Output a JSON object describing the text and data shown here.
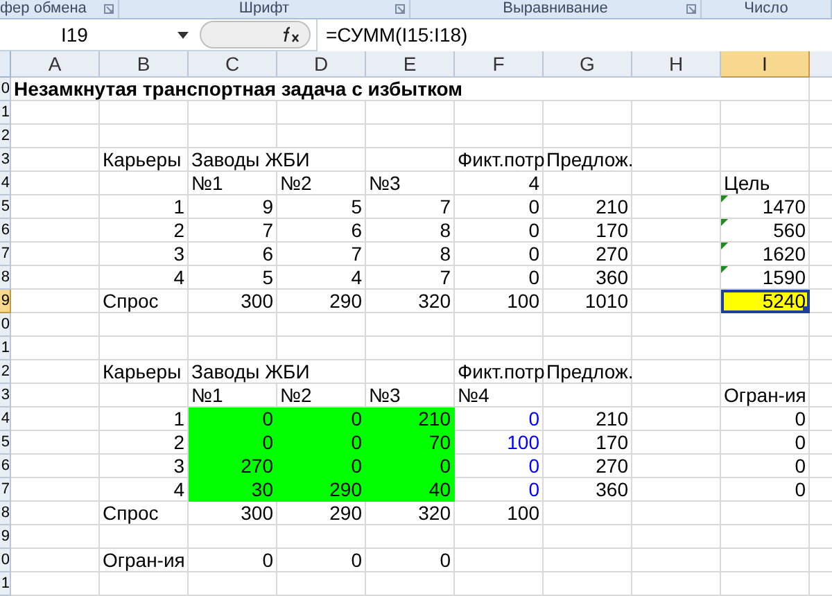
{
  "ribbon_groups": [
    {
      "label": "фер обмена"
    },
    {
      "label": "Шрифт"
    },
    {
      "label": "Выравнивание"
    },
    {
      "label": "Число"
    }
  ],
  "name_box": "I19",
  "formula": "=СУММ(I15:I18)",
  "columns": [
    {
      "label": "A",
      "selected": false
    },
    {
      "label": "B",
      "selected": false
    },
    {
      "label": "C",
      "selected": false
    },
    {
      "label": "D",
      "selected": false
    },
    {
      "label": "E",
      "selected": false
    },
    {
      "label": "F",
      "selected": false
    },
    {
      "label": "G",
      "selected": false
    },
    {
      "label": "H",
      "selected": false
    },
    {
      "label": "I",
      "selected": true
    }
  ],
  "rows": [
    {
      "number": "0",
      "selected": false,
      "cells": [
        {
          "text": "Незамкнутая транспортная задача с избытком",
          "kind": "title"
        },
        {
          "kind": "empty"
        },
        {
          "kind": "empty"
        },
        {
          "kind": "empty"
        },
        {
          "kind": "empty"
        },
        {
          "kind": "empty"
        },
        {
          "kind": "empty"
        },
        {
          "kind": "empty"
        },
        {
          "kind": "empty"
        }
      ]
    },
    {
      "number": "1",
      "selected": false,
      "cells": [
        {
          "kind": "empty"
        },
        {
          "kind": "empty"
        },
        {
          "kind": "empty"
        },
        {
          "kind": "empty"
        },
        {
          "kind": "empty"
        },
        {
          "kind": "empty"
        },
        {
          "kind": "empty"
        },
        {
          "kind": "empty"
        },
        {
          "kind": "empty"
        }
      ]
    },
    {
      "number": "2",
      "selected": false,
      "cells": [
        {
          "kind": "empty"
        },
        {
          "kind": "empty"
        },
        {
          "kind": "empty"
        },
        {
          "kind": "empty"
        },
        {
          "kind": "empty"
        },
        {
          "kind": "empty"
        },
        {
          "kind": "empty"
        },
        {
          "kind": "empty"
        },
        {
          "kind": "empty"
        }
      ]
    },
    {
      "number": "3",
      "selected": false,
      "cells": [
        {
          "kind": "empty"
        },
        {
          "text": "Карьеры",
          "kind": "text"
        },
        {
          "text": "Заводы ЖБИ",
          "kind": "text"
        },
        {
          "kind": "empty"
        },
        {
          "kind": "empty"
        },
        {
          "text": "Фикт.потр",
          "kind": "text"
        },
        {
          "text": "Предлож.",
          "kind": "text"
        },
        {
          "kind": "empty"
        },
        {
          "kind": "empty"
        }
      ]
    },
    {
      "number": "4",
      "selected": false,
      "cells": [
        {
          "kind": "empty"
        },
        {
          "kind": "empty"
        },
        {
          "text": "№1",
          "kind": "text"
        },
        {
          "text": "№2",
          "kind": "text"
        },
        {
          "text": "№3",
          "kind": "text"
        },
        {
          "text": "4",
          "kind": "number"
        },
        {
          "kind": "empty"
        },
        {
          "kind": "empty"
        },
        {
          "text": "Цель",
          "kind": "text"
        }
      ]
    },
    {
      "number": "5",
      "selected": false,
      "cells": [
        {
          "kind": "empty"
        },
        {
          "text": "1",
          "kind": "number"
        },
        {
          "text": "9",
          "kind": "number"
        },
        {
          "text": "5",
          "kind": "number"
        },
        {
          "text": "7",
          "kind": "number"
        },
        {
          "text": "0",
          "kind": "number"
        },
        {
          "text": "210",
          "kind": "number"
        },
        {
          "kind": "empty"
        },
        {
          "text": "1470",
          "kind": "flagged"
        }
      ]
    },
    {
      "number": "6",
      "selected": false,
      "cells": [
        {
          "kind": "empty"
        },
        {
          "text": "2",
          "kind": "number"
        },
        {
          "text": "7",
          "kind": "number"
        },
        {
          "text": "6",
          "kind": "number"
        },
        {
          "text": "8",
          "kind": "number"
        },
        {
          "text": "0",
          "kind": "number"
        },
        {
          "text": "170",
          "kind": "number"
        },
        {
          "kind": "empty"
        },
        {
          "text": "560",
          "kind": "flagged"
        }
      ]
    },
    {
      "number": "7",
      "selected": false,
      "cells": [
        {
          "kind": "empty"
        },
        {
          "text": "3",
          "kind": "number"
        },
        {
          "text": "6",
          "kind": "number"
        },
        {
          "text": "7",
          "kind": "number"
        },
        {
          "text": "8",
          "kind": "number"
        },
        {
          "text": "0",
          "kind": "number"
        },
        {
          "text": "270",
          "kind": "number"
        },
        {
          "kind": "empty"
        },
        {
          "text": "1620",
          "kind": "flagged"
        }
      ]
    },
    {
      "number": "8",
      "selected": false,
      "cells": [
        {
          "kind": "empty"
        },
        {
          "text": "4",
          "kind": "number"
        },
        {
          "text": "5",
          "kind": "number"
        },
        {
          "text": "4",
          "kind": "number"
        },
        {
          "text": "7",
          "kind": "number"
        },
        {
          "text": "0",
          "kind": "number"
        },
        {
          "text": "360",
          "kind": "number"
        },
        {
          "kind": "empty"
        },
        {
          "text": "1590",
          "kind": "flagged"
        }
      ]
    },
    {
      "number": "9",
      "selected": true,
      "cells": [
        {
          "kind": "empty"
        },
        {
          "text": "Спрос",
          "kind": "text"
        },
        {
          "text": "300",
          "kind": "number"
        },
        {
          "text": "290",
          "kind": "number"
        },
        {
          "text": "320",
          "kind": "number"
        },
        {
          "text": "100",
          "kind": "number"
        },
        {
          "text": "1010",
          "kind": "number"
        },
        {
          "kind": "empty"
        },
        {
          "text": "5240",
          "kind": "active"
        }
      ]
    },
    {
      "number": "0",
      "selected": false,
      "cells": [
        {
          "kind": "empty"
        },
        {
          "kind": "empty"
        },
        {
          "kind": "empty"
        },
        {
          "kind": "empty"
        },
        {
          "kind": "empty"
        },
        {
          "kind": "empty"
        },
        {
          "kind": "empty"
        },
        {
          "kind": "empty"
        },
        {
          "kind": "empty"
        }
      ]
    },
    {
      "number": "1",
      "selected": false,
      "cells": [
        {
          "kind": "empty"
        },
        {
          "kind": "empty"
        },
        {
          "kind": "empty"
        },
        {
          "kind": "empty"
        },
        {
          "kind": "empty"
        },
        {
          "kind": "empty"
        },
        {
          "kind": "empty"
        },
        {
          "kind": "empty"
        },
        {
          "kind": "empty"
        }
      ]
    },
    {
      "number": "2",
      "selected": false,
      "cells": [
        {
          "kind": "empty"
        },
        {
          "text": "Карьеры",
          "kind": "text"
        },
        {
          "text": "Заводы ЖБИ",
          "kind": "text"
        },
        {
          "kind": "empty"
        },
        {
          "kind": "empty"
        },
        {
          "text": "Фикт.потр",
          "kind": "text"
        },
        {
          "text": "Предлож.",
          "kind": "text"
        },
        {
          "kind": "empty"
        },
        {
          "kind": "empty"
        }
      ]
    },
    {
      "number": "3",
      "selected": false,
      "cells": [
        {
          "kind": "empty"
        },
        {
          "kind": "empty"
        },
        {
          "text": "№1",
          "kind": "text"
        },
        {
          "text": "№2",
          "kind": "text"
        },
        {
          "text": "№3",
          "kind": "text"
        },
        {
          "text": "№4",
          "kind": "text"
        },
        {
          "kind": "empty"
        },
        {
          "kind": "empty"
        },
        {
          "text": "Огран-ия",
          "kind": "text"
        }
      ]
    },
    {
      "number": "4",
      "selected": false,
      "cells": [
        {
          "kind": "empty"
        },
        {
          "text": "1",
          "kind": "number"
        },
        {
          "text": "0",
          "kind": "filled"
        },
        {
          "text": "0",
          "kind": "filled"
        },
        {
          "text": "210",
          "kind": "filled"
        },
        {
          "text": "0",
          "kind": "blue"
        },
        {
          "text": "210",
          "kind": "number"
        },
        {
          "kind": "empty"
        },
        {
          "text": "0",
          "kind": "number"
        }
      ]
    },
    {
      "number": "5",
      "selected": false,
      "cells": [
        {
          "kind": "empty"
        },
        {
          "text": "2",
          "kind": "number"
        },
        {
          "text": "0",
          "kind": "filled"
        },
        {
          "text": "0",
          "kind": "filled"
        },
        {
          "text": "70",
          "kind": "filled"
        },
        {
          "text": "100",
          "kind": "blue"
        },
        {
          "text": "170",
          "kind": "number"
        },
        {
          "kind": "empty"
        },
        {
          "text": "0",
          "kind": "number"
        }
      ]
    },
    {
      "number": "6",
      "selected": false,
      "cells": [
        {
          "kind": "empty"
        },
        {
          "text": "3",
          "kind": "number"
        },
        {
          "text": "270",
          "kind": "filled"
        },
        {
          "text": "0",
          "kind": "filled"
        },
        {
          "text": "0",
          "kind": "filled"
        },
        {
          "text": "0",
          "kind": "blue"
        },
        {
          "text": "270",
          "kind": "number"
        },
        {
          "kind": "empty"
        },
        {
          "text": "0",
          "kind": "number"
        }
      ]
    },
    {
      "number": "7",
      "selected": false,
      "cells": [
        {
          "kind": "empty"
        },
        {
          "text": "4",
          "kind": "number"
        },
        {
          "text": "30",
          "kind": "filled"
        },
        {
          "text": "290",
          "kind": "filled"
        },
        {
          "text": "40",
          "kind": "filled"
        },
        {
          "text": "0",
          "kind": "blue"
        },
        {
          "text": "360",
          "kind": "number"
        },
        {
          "kind": "empty"
        },
        {
          "text": "0",
          "kind": "number"
        }
      ]
    },
    {
      "number": "8",
      "selected": false,
      "cells": [
        {
          "kind": "empty"
        },
        {
          "text": "Спрос",
          "kind": "text"
        },
        {
          "text": "300",
          "kind": "number"
        },
        {
          "text": "290",
          "kind": "number"
        },
        {
          "text": "320",
          "kind": "number"
        },
        {
          "text": "100",
          "kind": "number"
        },
        {
          "kind": "empty"
        },
        {
          "kind": "empty"
        },
        {
          "kind": "empty"
        }
      ]
    },
    {
      "number": "9",
      "selected": false,
      "cells": [
        {
          "kind": "empty"
        },
        {
          "kind": "empty"
        },
        {
          "kind": "empty"
        },
        {
          "kind": "empty"
        },
        {
          "kind": "empty"
        },
        {
          "kind": "empty"
        },
        {
          "kind": "empty"
        },
        {
          "kind": "empty"
        },
        {
          "kind": "empty"
        }
      ]
    },
    {
      "number": "0",
      "selected": false,
      "cells": [
        {
          "kind": "empty"
        },
        {
          "text": "Огран-ия",
          "kind": "text"
        },
        {
          "text": "0",
          "kind": "number"
        },
        {
          "text": "0",
          "kind": "number"
        },
        {
          "text": "0",
          "kind": "number"
        },
        {
          "kind": "empty"
        },
        {
          "kind": "empty"
        },
        {
          "kind": "empty"
        },
        {
          "kind": "empty"
        }
      ]
    },
    {
      "number": "1",
      "selected": false,
      "cells": [
        {
          "kind": "empty"
        },
        {
          "kind": "empty"
        },
        {
          "kind": "empty"
        },
        {
          "kind": "empty"
        },
        {
          "kind": "empty"
        },
        {
          "kind": "empty"
        },
        {
          "kind": "empty"
        },
        {
          "kind": "empty"
        },
        {
          "kind": "empty"
        }
      ]
    }
  ]
}
